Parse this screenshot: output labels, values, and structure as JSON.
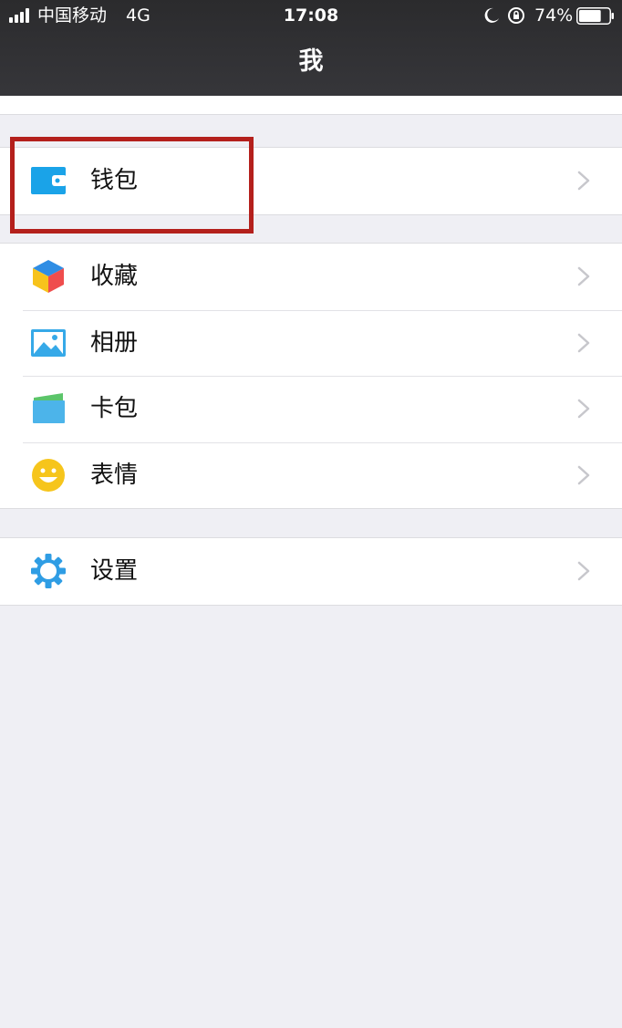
{
  "status_bar": {
    "carrier": "中国移动",
    "network": "4G",
    "time": "17:08",
    "battery_percent": "74%",
    "battery_level": 0.74,
    "icons": [
      "signal-icon",
      "moon-icon",
      "rotation-lock-icon",
      "battery-icon"
    ]
  },
  "nav": {
    "title": "我"
  },
  "groups": {
    "wallet_group": {
      "items": [
        {
          "label": "钱包",
          "icon": "wallet-icon"
        }
      ]
    },
    "main_group": {
      "items": [
        {
          "label": "收藏",
          "icon": "favorites-cube-icon"
        },
        {
          "label": "相册",
          "icon": "album-icon"
        },
        {
          "label": "卡包",
          "icon": "card-pack-icon"
        },
        {
          "label": "表情",
          "icon": "sticker-smiley-icon"
        }
      ]
    },
    "settings_group": {
      "items": [
        {
          "label": "设置",
          "icon": "settings-gear-icon"
        }
      ]
    }
  },
  "colors": {
    "nav_background": "#2b2b2d",
    "page_background": "#efeff4",
    "highlight_border": "#b4201c",
    "wallet_blue": "#1aa3e8",
    "chevron": "#c7c7cc"
  }
}
